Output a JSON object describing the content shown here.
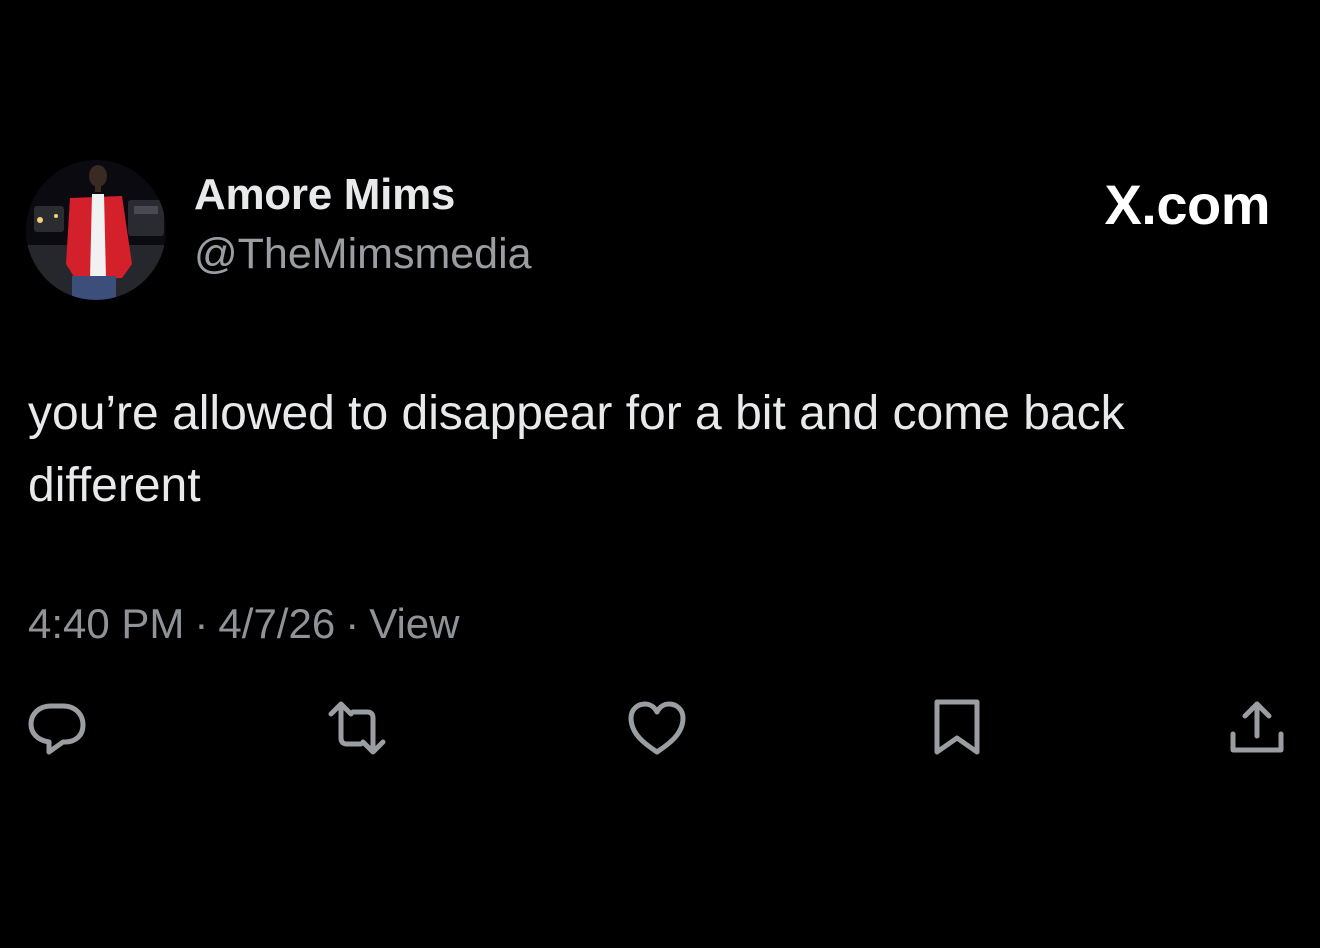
{
  "author": {
    "name": "Amore Mims",
    "handle": "@TheMimsmedia"
  },
  "brand": {
    "label": "X.com"
  },
  "tweet": {
    "text": "you’re allowed to disappear for a bit and come back different"
  },
  "meta": {
    "time": "4:40 PM",
    "separator": "·",
    "date": "4/7/26",
    "views": "View"
  },
  "actions": {
    "reply_icon": "reply-icon",
    "repost_icon": "repost-icon",
    "like_icon": "heart-icon",
    "bookmark_icon": "bookmark-icon",
    "share_icon": "share-icon"
  },
  "colors": {
    "background": "#000000",
    "primary_text": "#e7e9ea",
    "secondary_text": "#8f9397",
    "icon": "#9a9ea3",
    "avatar_jacket": "#d3202a"
  }
}
